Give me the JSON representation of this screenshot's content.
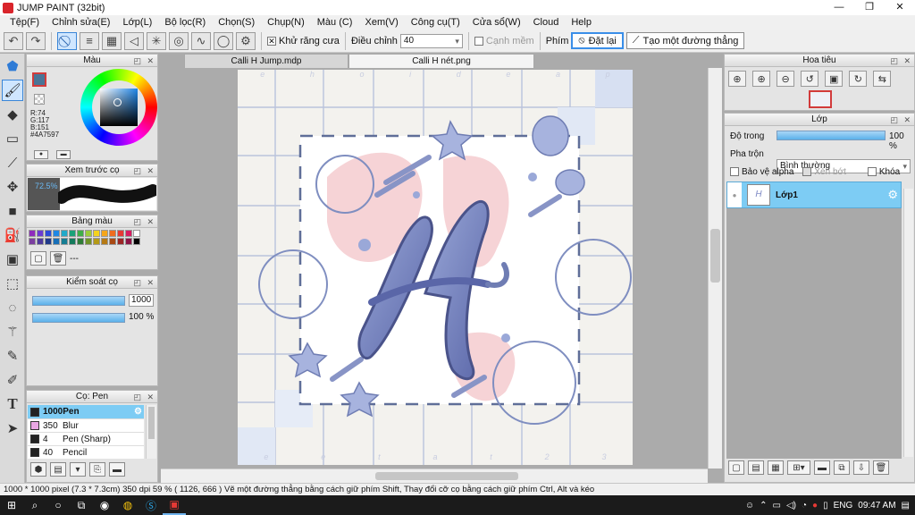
{
  "window": {
    "title": "JUMP PAINT (32bit)",
    "min": "—",
    "max": "❐",
    "close": "✕"
  },
  "menu": [
    "Tệp(F)",
    "Chỉnh sửa(E)",
    "Lớp(L)",
    "Bộ lọc(R)",
    "Chọn(S)",
    "Chụp(N)",
    "Màu (C)",
    "Xem(V)",
    "Công cụ(T)",
    "Cửa sổ(W)",
    "Cloud",
    "Help"
  ],
  "toolbar": {
    "antialias_label": "Khử răng cưa",
    "adjust_label": "Điều chỉnh",
    "adjust_value": "40",
    "smooth_label": "Cạnh mềm",
    "key_label": "Phím",
    "reset_label": "Đặt lại",
    "make_line_label": "Tạo một đường thẳng"
  },
  "color_panel": {
    "title": "Màu",
    "r": "R:74",
    "g": "G:117",
    "b": "B:151",
    "hex": "#4A7597",
    "fg_color": "#4a7597"
  },
  "brush_preview": {
    "title": "Xem trước cọ",
    "percent": "72.5%"
  },
  "palette": {
    "title": "Bảng màu",
    "extra": "---",
    "colors": [
      "#8f2bbd",
      "#6a3bd1",
      "#2c4bd8",
      "#1e88e5",
      "#21a9c9",
      "#1aa179",
      "#3fae49",
      "#9ccc3a",
      "#f4d21e",
      "#f5a61a",
      "#ef6c1e",
      "#e53935",
      "#d81b60",
      "#ffffff",
      "#7b3fa0",
      "#4e3a9c",
      "#203a8a",
      "#176fb8",
      "#157d93",
      "#147a5b",
      "#2f7d37",
      "#6f9328",
      "#b59a16",
      "#b67a14",
      "#a94a14",
      "#9c2626",
      "#8c1446",
      "#000000"
    ]
  },
  "brush_control": {
    "title": "Kiểm soát cọ",
    "size_value": "1000",
    "opacity_value": "100 %"
  },
  "brush_list": {
    "title": "Cọ: Pen",
    "items": [
      {
        "size": "1000",
        "name": "Pen",
        "swatch": "#222222"
      },
      {
        "size": "350",
        "name": "Blur",
        "swatch": "#e9a7e4"
      },
      {
        "size": "4",
        "name": "Pen (Sharp)",
        "swatch": "#222222"
      },
      {
        "size": "40",
        "name": "Pencil",
        "swatch": "#222222"
      }
    ]
  },
  "tabs": [
    "Calli H Jump.mdp",
    "Calli H nét.png"
  ],
  "canvas": {
    "top_letters": [
      "e",
      "h",
      "o",
      "i",
      "d",
      "e",
      "a",
      "p"
    ],
    "bottom_letters": [
      "e",
      "e",
      "t",
      "a",
      "t",
      "2",
      "3"
    ]
  },
  "navigator": {
    "title": "Hoa tiêu"
  },
  "layers": {
    "title": "Lớp",
    "opacity_label": "Độ trong",
    "opacity_value": "100 %",
    "blend_label": "Pha trộn",
    "blend_value": "Bình thường",
    "protect_alpha": "Bảo vệ alpha",
    "clipping": "Xén bớt",
    "lock": "Khóa",
    "layer_name": "Lớp1"
  },
  "status": {
    "text": "1000 * 1000 pixel   (7.3 * 7.3cm)   350 dpi   59 %   ( 1126, 666 )   Vẽ một đường thẳng bằng cách giữ phím Shift, Thay đổi cỡ cọ bằng cách giữ phím Ctrl, Alt và kéo"
  },
  "taskbar": {
    "lang": "ENG",
    "time": "09:47 AM"
  },
  "colors": {
    "accent": "#3a8ee8",
    "layer_selected": "#7dccf4",
    "canvas_bg": "#f3f2ee"
  }
}
